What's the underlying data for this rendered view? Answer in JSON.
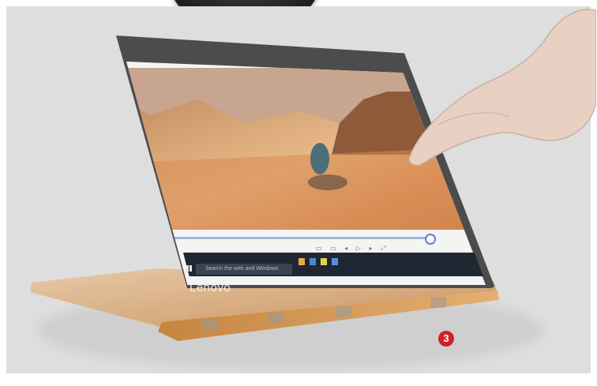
{
  "photo": {
    "description_label": "",
    "callout_number": "3",
    "screen": {
      "brand_text": "Lenovo",
      "search_placeholder": "Search the web and Windows",
      "callout_color": "#d0202a"
    }
  }
}
